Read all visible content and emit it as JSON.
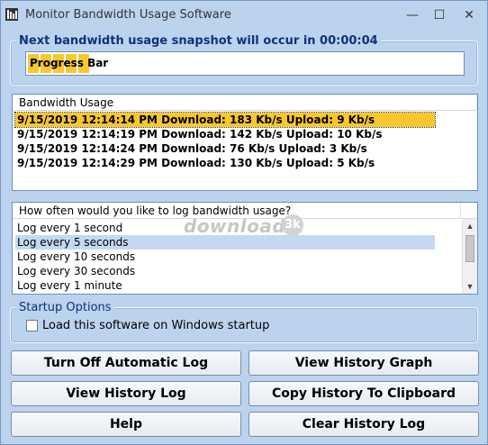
{
  "window": {
    "title": "Monitor Bandwidth Usage Software",
    "minimize": "—",
    "maximize": "☐",
    "close": "✕"
  },
  "snapshot_group": {
    "legend": "Next bandwidth usage snapshot will occur in 00:00:04",
    "progress_text": "Progress Bar",
    "progress_segments": 5,
    "progress_color": "#f8c72e"
  },
  "bandwidth_list": {
    "header": "Bandwidth Usage",
    "rows": [
      "9/15/2019 12:14:14 PM Download: 183 Kb/s Upload: 9 Kb/s",
      "9/15/2019 12:14:19 PM Download: 142 Kb/s Upload: 10 Kb/s",
      "9/15/2019 12:14:24 PM Download: 76 Kb/s Upload: 3 Kb/s",
      "9/15/2019 12:14:29 PM Download: 130 Kb/s Upload: 5 Kb/s"
    ],
    "selected_index": 0
  },
  "log_interval_list": {
    "header": "How often would you like to log bandwidth usage?",
    "options": [
      "Log every 1 second",
      "Log every 5 seconds",
      "Log every 10 seconds",
      "Log every 30 seconds",
      "Log every 1 minute"
    ],
    "selected_index": 1,
    "watermark": "download",
    "watermark_badge": "3k"
  },
  "startup_group": {
    "legend": "Startup Options",
    "checkbox_label": "Load this software on Windows startup",
    "checked": false
  },
  "buttons": {
    "turn_off_log": "Turn Off Automatic Log",
    "view_history_graph": "View History Graph",
    "view_history_log": "View History Log",
    "copy_history": "Copy History To Clipboard",
    "help": "Help",
    "clear_history_log": "Clear History Log"
  },
  "colors": {
    "window_bg": "#bcd3ee",
    "legend_text": "#10307a",
    "selection_orange": "#f8c72e",
    "selection_blue": "#c4d8f2"
  }
}
